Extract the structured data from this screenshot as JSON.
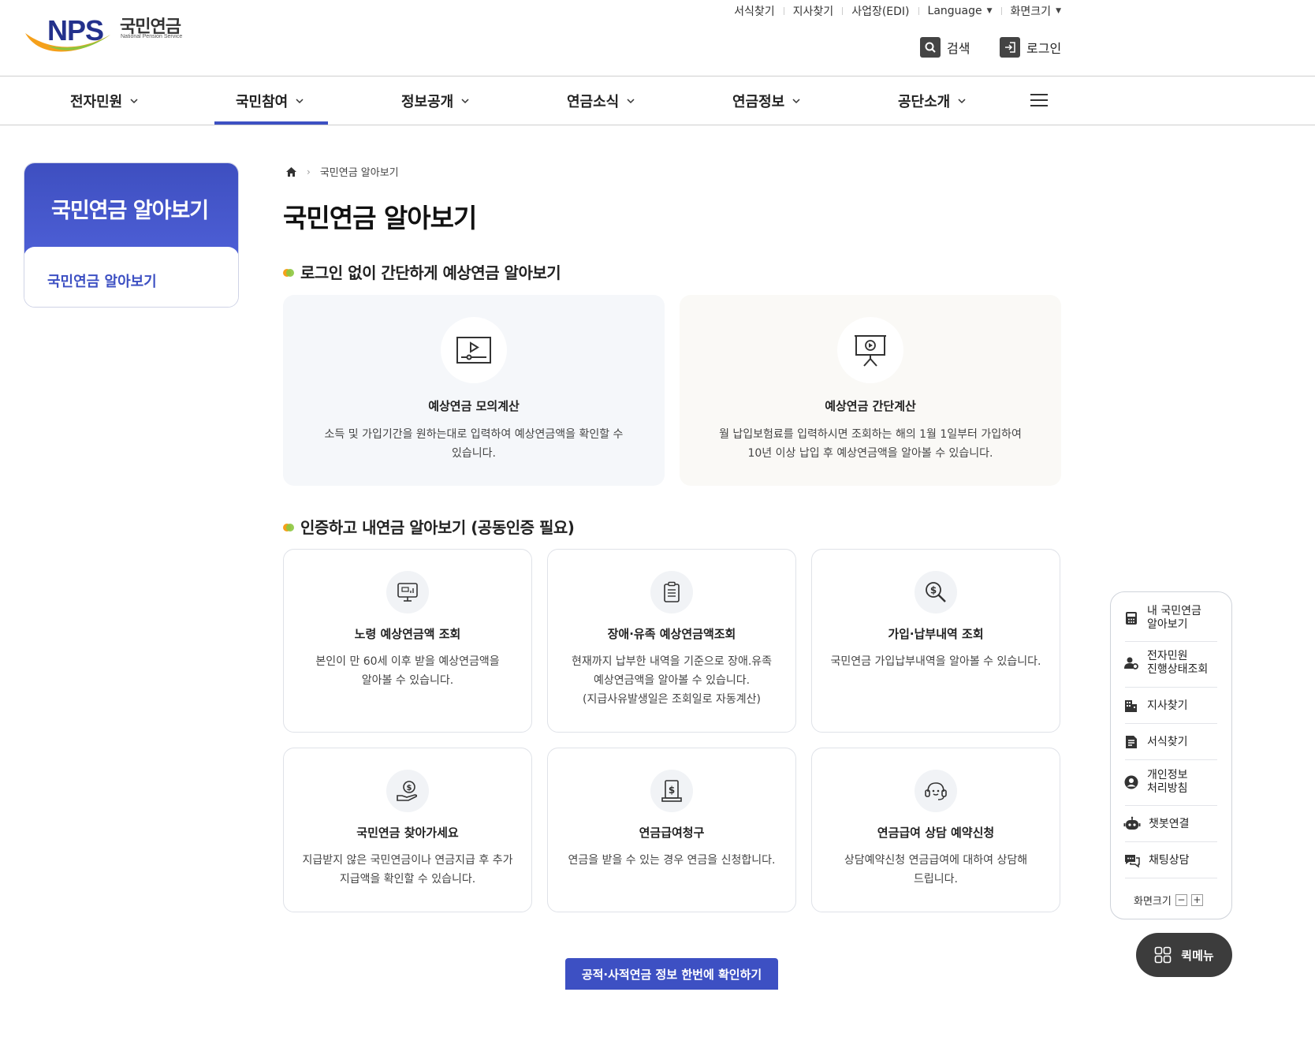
{
  "logo": {
    "brand": "NPS",
    "name_ko": "국민연금",
    "name_en": "National Pension Service"
  },
  "util_links": [
    "서식찾기",
    "지사찾기",
    "사업장(EDI)",
    "Language",
    "화면크기"
  ],
  "header_buttons": {
    "search": "검색",
    "login": "로그인"
  },
  "gnb": [
    "전자민원",
    "국민참여",
    "정보공개",
    "연금소식",
    "연금정보",
    "공단소개"
  ],
  "gnb_active": "국민참여",
  "side": {
    "title": "국민연금 알아보기",
    "item": "국민연금 알아보기"
  },
  "breadcrumb": {
    "current": "국민연금 알아보기"
  },
  "page_title": "국민연금 알아보기",
  "section1": {
    "title": "로그인 없이 간단하게 예상연금 알아보기",
    "cards": [
      {
        "title": "예상연금 모의계산",
        "desc1": "소득 및 가입기간을 원하는대로 입력하여 예상연금액을 확인할 수",
        "desc2": "있습니다."
      },
      {
        "title": "예상연금 간단계산",
        "desc1": "월 납입보험료를 입력하시면 조회하는 해의 1월 1일부터 가입하여",
        "desc2": "10년 이상 납입 후 예상연금액을 알아볼 수 있습니다."
      }
    ]
  },
  "section2": {
    "title": "인증하고 내연금 알아보기 (공동인증 필요)",
    "cards": [
      {
        "title": "노령 예상연금액 조회",
        "lines": [
          "본인이 만 60세 이후 받을 예상연금액을",
          "알아볼 수 있습니다."
        ]
      },
      {
        "title": "장애·유족 예상연금액조회",
        "lines": [
          "현재까지 납부한 내역을 기준으로 장애.유족",
          "예상연금액을 알아볼 수 있습니다.",
          "(지급사유발생일은 조회일로 자동계산)"
        ]
      },
      {
        "title": "가입·납부내역 조회",
        "lines": [
          "국민연금 가입납부내역을 알아볼 수 있습니다."
        ]
      },
      {
        "title": "국민연금 찾아가세요",
        "lines": [
          "지급받지 않은 국민연금이나 연금지급 후 추가",
          "지급액을 확인할 수 있습니다."
        ]
      },
      {
        "title": "연금급여청구",
        "lines": [
          "연금을 받을 수 있는 경우 연금을 신청합니다."
        ]
      },
      {
        "title": "연금급여 상담 예약신청",
        "lines": [
          "상담예약신청 연금급여에 대하여 상담해",
          "드립니다."
        ]
      }
    ]
  },
  "bottom_button": "공적·사적연금 정보 한번에 확인하기",
  "quick": {
    "items": [
      [
        "내 국민연금",
        "알아보기"
      ],
      [
        "전자민원",
        "진행상태조회"
      ],
      [
        "지사찾기"
      ],
      [
        "서식찾기"
      ],
      [
        "개인정보",
        "처리방침"
      ],
      [
        "챗봇연결"
      ],
      [
        "채팅상담"
      ]
    ],
    "font_size_label": "화면크기",
    "minus": "−",
    "plus": "+"
  },
  "quick_menu_label": "퀵메뉴",
  "colors": {
    "primary": "#3d50c3",
    "brand_navy": "#23318c",
    "dark": "#3c3c3c"
  }
}
